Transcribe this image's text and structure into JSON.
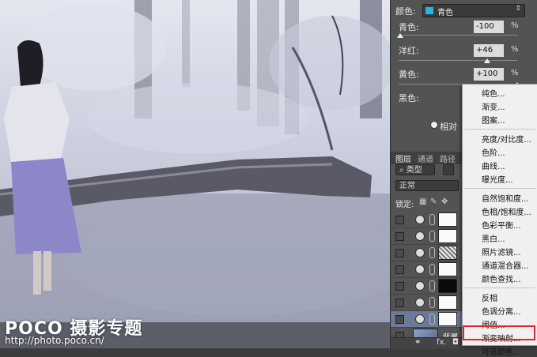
{
  "photo": {
    "watermark_brand": "POCO 摄影专题",
    "watermark_url": "http://photo.poco.cn/"
  },
  "properties": {
    "colors_label": "颜色:",
    "colors_value": "青色",
    "colors_swatch": "#26b4e8",
    "sliders": [
      {
        "label": "青色:",
        "value": "-100",
        "unit": "%",
        "level": -100
      },
      {
        "label": "洋红:",
        "value": "+46",
        "unit": "%",
        "level": 46
      },
      {
        "label": "黄色:",
        "value": "+100",
        "unit": "%",
        "level": 100
      },
      {
        "label": "黑色:",
        "value": "",
        "unit": "",
        "level": 0
      }
    ],
    "method_label": "相对"
  },
  "layers_panel": {
    "tabs": [
      "图层",
      "通道",
      "路径"
    ],
    "filter_kind": "类型",
    "blend_mode": "正常",
    "lock_label": "锁定:",
    "layers": [
      {
        "name": "",
        "thumb": "white",
        "visible": false
      },
      {
        "name": "",
        "thumb": "white",
        "visible": false
      },
      {
        "name": "",
        "thumb": "noise",
        "visible": false
      },
      {
        "name": "",
        "thumb": "white",
        "visible": false
      },
      {
        "name": "",
        "thumb": "black",
        "visible": false
      },
      {
        "name": "",
        "thumb": "white",
        "visible": false
      },
      {
        "name": "",
        "thumb": "white",
        "visible": true
      },
      {
        "name": "背景",
        "thumb": "photo",
        "visible": true
      }
    ],
    "footer_fx": "fx."
  },
  "adjustment_menu": {
    "groups": [
      [
        "纯色...",
        "渐变...",
        "图案..."
      ],
      [
        "亮度/对比度...",
        "色阶...",
        "曲线...",
        "曝光度..."
      ],
      [
        "自然饱和度...",
        "色相/饱和度...",
        "色彩平衡...",
        "黑白...",
        "照片滤镜...",
        "通道混合器...",
        "颜色查找..."
      ],
      [
        "反相",
        "色调分离...",
        "阈值...",
        "渐变映射...",
        "可选颜色..."
      ]
    ],
    "highlighted": "可选颜色...",
    "highlight_color": "#e0262c"
  }
}
